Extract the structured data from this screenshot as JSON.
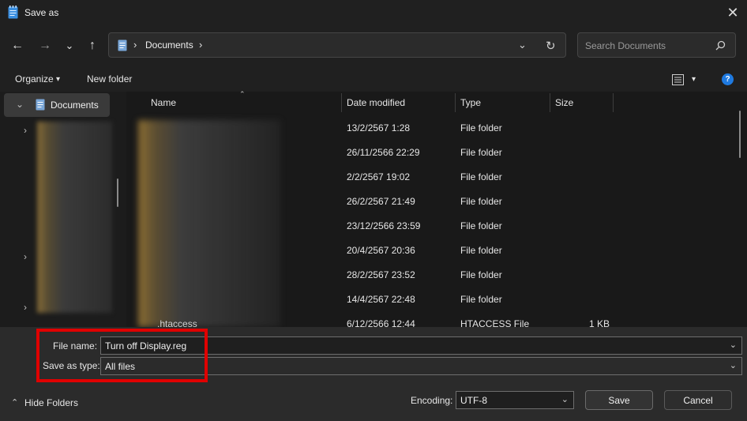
{
  "window": {
    "title": "Save as",
    "close_glyph": "✕"
  },
  "nav": {
    "back_glyph": "←",
    "forward_glyph": "→",
    "recent_glyph": "⌄",
    "up_glyph": "↑",
    "breadcrumb": [
      "Documents"
    ],
    "sep_glyph": "›",
    "refresh_glyph": "↻",
    "dropdown_glyph": "⌄"
  },
  "search": {
    "placeholder": "Search Documents",
    "icon": "search-icon"
  },
  "commandbar": {
    "organize": "Organize",
    "organize_chev": "▾",
    "new_folder": "New folder",
    "view_chev": "▾",
    "help": "?"
  },
  "navpane": {
    "selected": "Documents"
  },
  "columns": {
    "name": "Name",
    "date": "Date modified",
    "type": "Type",
    "size": "Size"
  },
  "rows": [
    {
      "name": "",
      "date": "13/2/2567 1:28",
      "type": "File folder",
      "size": ""
    },
    {
      "name": "",
      "date": "26/11/2566 22:29",
      "type": "File folder",
      "size": ""
    },
    {
      "name": "",
      "date": "2/2/2567 19:02",
      "type": "File folder",
      "size": ""
    },
    {
      "name": "",
      "date": "26/2/2567 21:49",
      "type": "File folder",
      "size": ""
    },
    {
      "name": "",
      "date": "23/12/2566 23:59",
      "type": "File folder",
      "size": ""
    },
    {
      "name": "",
      "date": "20/4/2567 20:36",
      "type": "File folder",
      "size": ""
    },
    {
      "name": "",
      "date": "28/2/2567 23:52",
      "type": "File folder",
      "size": ""
    },
    {
      "name": "",
      "date": "14/4/2567 22:48",
      "type": "File folder",
      "size": ""
    },
    {
      "name": ".htaccess",
      "date": "6/12/2566 12:44",
      "type": "HTACCESS File",
      "size": "1 KB"
    }
  ],
  "form": {
    "file_name_label": "File name:",
    "file_name_value": "Turn off Display.reg",
    "save_type_label": "Save as type:",
    "save_type_value": "All files",
    "chev": "⌄"
  },
  "footer": {
    "hide_folders": "Hide Folders",
    "hide_chev": "⌃",
    "encoding_label": "Encoding:",
    "encoding_value": "UTF-8",
    "save": "Save",
    "cancel": "Cancel"
  },
  "colors": {
    "highlight": "#e00000",
    "accent": "#0a84ff"
  }
}
